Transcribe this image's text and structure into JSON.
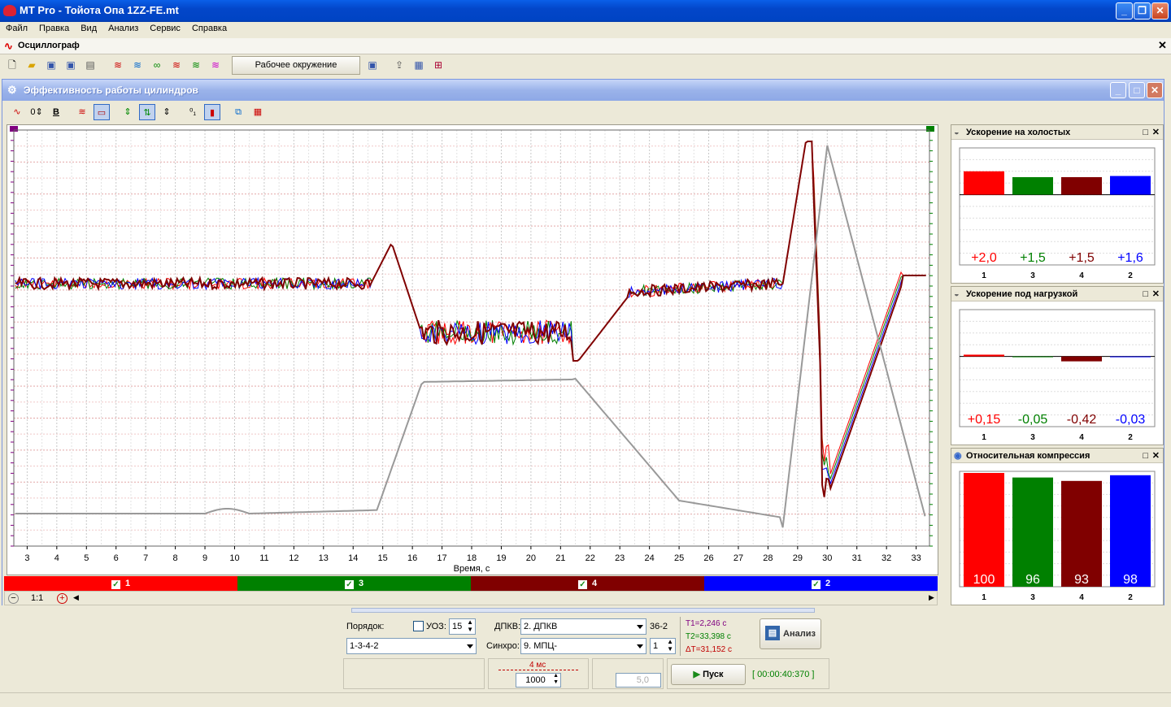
{
  "app": {
    "title": "MT Pro - Тойота Опа 1ZZ-FE.mt"
  },
  "menu": [
    "Файл",
    "Правка",
    "Вид",
    "Анализ",
    "Сервис",
    "Справка"
  ],
  "oscilloscope_bar": {
    "title": "Осциллограф"
  },
  "toolbar": {
    "env_button": "Рабочее окружение"
  },
  "inner_window": {
    "title": "Эффективность работы цилиндров"
  },
  "colors": {
    "cyl1": "#ff0000",
    "cyl3": "#008000",
    "cyl4": "#800000",
    "cyl2": "#0000ff",
    "gray": "#999999"
  },
  "chart": {
    "xlabel": "Время, с",
    "x_ticks": [
      "3",
      "4",
      "5",
      "6",
      "7",
      "8",
      "9",
      "10",
      "11",
      "12",
      "13",
      "14",
      "15",
      "16",
      "17",
      "18",
      "19",
      "20",
      "21",
      "22",
      "23",
      "24",
      "25",
      "26",
      "27",
      "28",
      "29",
      "30",
      "31",
      "32",
      "33"
    ],
    "xlim": [
      2.55,
      33.45
    ]
  },
  "legend": [
    {
      "label": "1",
      "color": "#ff0000"
    },
    {
      "label": "3",
      "color": "#008000"
    },
    {
      "label": "4",
      "color": "#800000"
    },
    {
      "label": "2",
      "color": "#0000ff"
    }
  ],
  "scroll": {
    "zoom": "1:1"
  },
  "panels": [
    {
      "title": "Ускорение на холостых",
      "type": "bar",
      "categories": [
        "1",
        "3",
        "4",
        "2"
      ],
      "values": [
        2.0,
        1.5,
        1.5,
        1.6
      ],
      "labels": [
        "+2,0",
        "+1,5",
        "+1,5",
        "+1,6"
      ]
    },
    {
      "title": "Ускорение под нагрузкой",
      "type": "bar",
      "categories": [
        "1",
        "3",
        "4",
        "2"
      ],
      "values": [
        0.15,
        -0.05,
        -0.42,
        -0.03
      ],
      "labels": [
        "+0,15",
        "-0,05",
        "-0,42",
        "-0,03"
      ]
    },
    {
      "title": "Относительная компрессия",
      "type": "bar",
      "categories": [
        "1",
        "3",
        "4",
        "2"
      ],
      "values": [
        100,
        96,
        93,
        98
      ],
      "labels": [
        "100",
        "96",
        "93",
        "98"
      ]
    }
  ],
  "settings": {
    "order_label": "Порядок:",
    "order_value": "1-3-4-2",
    "uoz_label": "УОЗ:",
    "uoz_value": "15",
    "dpkv_label": "ДПКВ:",
    "dpkv_value": "2. ДПКВ",
    "dpkv_teeth": "36-2",
    "sync_label": "Синхро:",
    "sync_value": "9. МПЦ-",
    "sync_num": "1",
    "t1": "T1=2,246 с",
    "t2": "T2=33,398 с",
    "dt": "ΔT=31,152 с",
    "analyze_button": "Анализ"
  },
  "lower_controls": {
    "time_div": "4 мс",
    "samples": "1000",
    "level": "5,0",
    "start_button": "Пуск",
    "timer": "[ 00:00:40:370 ]"
  }
}
